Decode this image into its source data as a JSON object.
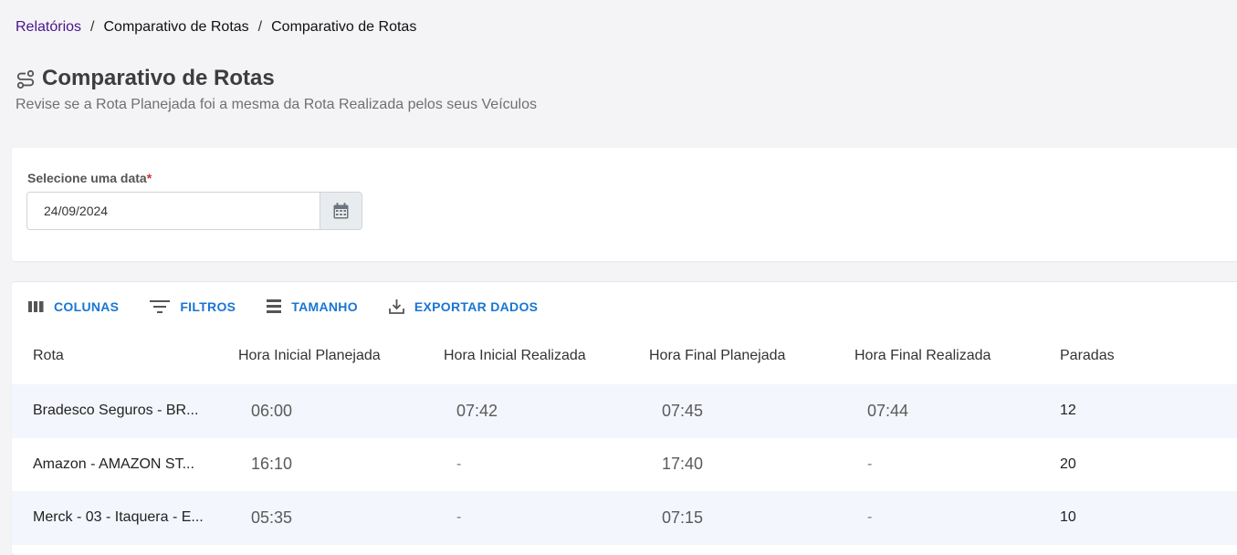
{
  "breadcrumb": {
    "root": "Relatórios",
    "level1": "Comparativo de Rotas",
    "level2": "Comparativo de Rotas",
    "separator": "/"
  },
  "header": {
    "icon": "route-icon",
    "title": "Comparativo de Rotas",
    "subtitle": "Revise se a Rota Planejada foi a mesma da Rota Realizada pelos seus Veículos"
  },
  "date_filter": {
    "label": "Selecione uma data",
    "required_mark": "*",
    "value": "24/09/2024",
    "button_icon": "calendar-icon"
  },
  "toolbar": {
    "columns": "COLUNAS",
    "filters": "FILTROS",
    "density": "TAMANHO",
    "export": "EXPORTAR DADOS"
  },
  "table": {
    "headers": [
      "Rota",
      "Hora Inicial Planejada",
      "Hora Inicial Realizada",
      "Hora Final Planejada",
      "Hora Final Realizada",
      "Paradas"
    ],
    "rows": [
      [
        "Bradesco Seguros - BR...",
        "06:00",
        "07:42",
        "07:45",
        "07:44",
        "12"
      ],
      [
        "Amazon - AMAZON ST...",
        "16:10",
        "-",
        "17:40",
        "-",
        "20"
      ],
      [
        "Merck - 03 - Itaquera - E...",
        "05:35",
        "-",
        "07:15",
        "-",
        "10"
      ]
    ]
  },
  "colors": {
    "accent": "#1976d2",
    "breadcrumb_link": "#4a148c",
    "required": "#d32f2f",
    "row_alt": "#f4f6fd"
  }
}
